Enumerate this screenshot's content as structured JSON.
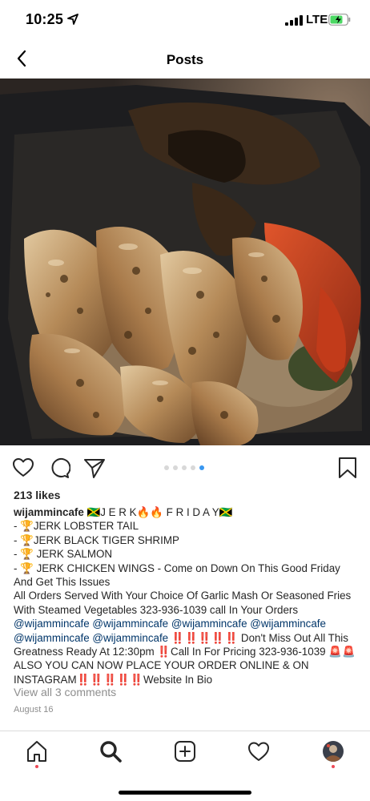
{
  "status_bar": {
    "time": "10:25",
    "carrier": "LTE"
  },
  "header": {
    "title": "Posts"
  },
  "post": {
    "image_description": "jerk seafood platter",
    "carousel": {
      "count": 5,
      "active_index": 4
    },
    "likes": "213 likes",
    "username": "wijammincafe",
    "caption_title": " 🇯🇲J E R K🔥🔥 F R I D A Y🇯🇲",
    "caption_lines": [
      "- 🏆JERK LOBSTER TAIL",
      "- 🏆JERK BLACK TIGER SHRIMP",
      "- 🏆 JERK SALMON",
      "- 🏆 JERK CHICKEN WINGS - Come on Down On This Good Friday And Get This Issues",
      "All Orders Served With Your Choice Of Garlic Mash Or Seasoned Fries With Steamed Vegetables 323-936-1039 call In Your Orders"
    ],
    "mentions": "@wijammincafe @wijammincafe @wijammincafe @wijammincafe @wijammincafe @wijammincafe",
    "caption_after_mentions": " ‼️‼️‼️‼️‼️ Don't Miss Out All This Greatness Ready At 12:30pm ‼️Call In For Pricing 323-936-1039 🚨🚨ALSO YOU CAN NOW PLACE YOUR ORDER ONLINE & ON INSTAGRAM‼️‼️‼️‼️‼️Website In Bio",
    "view_comments": "View all 3 comments",
    "date": "August 16"
  },
  "colors": {
    "accent": "#3897f0",
    "mention": "#003569",
    "muted": "#8e8e8e",
    "notification": "#ed4956"
  },
  "tabs": [
    "home-icon",
    "search-icon",
    "add-icon",
    "heart-icon",
    "profile-avatar"
  ]
}
